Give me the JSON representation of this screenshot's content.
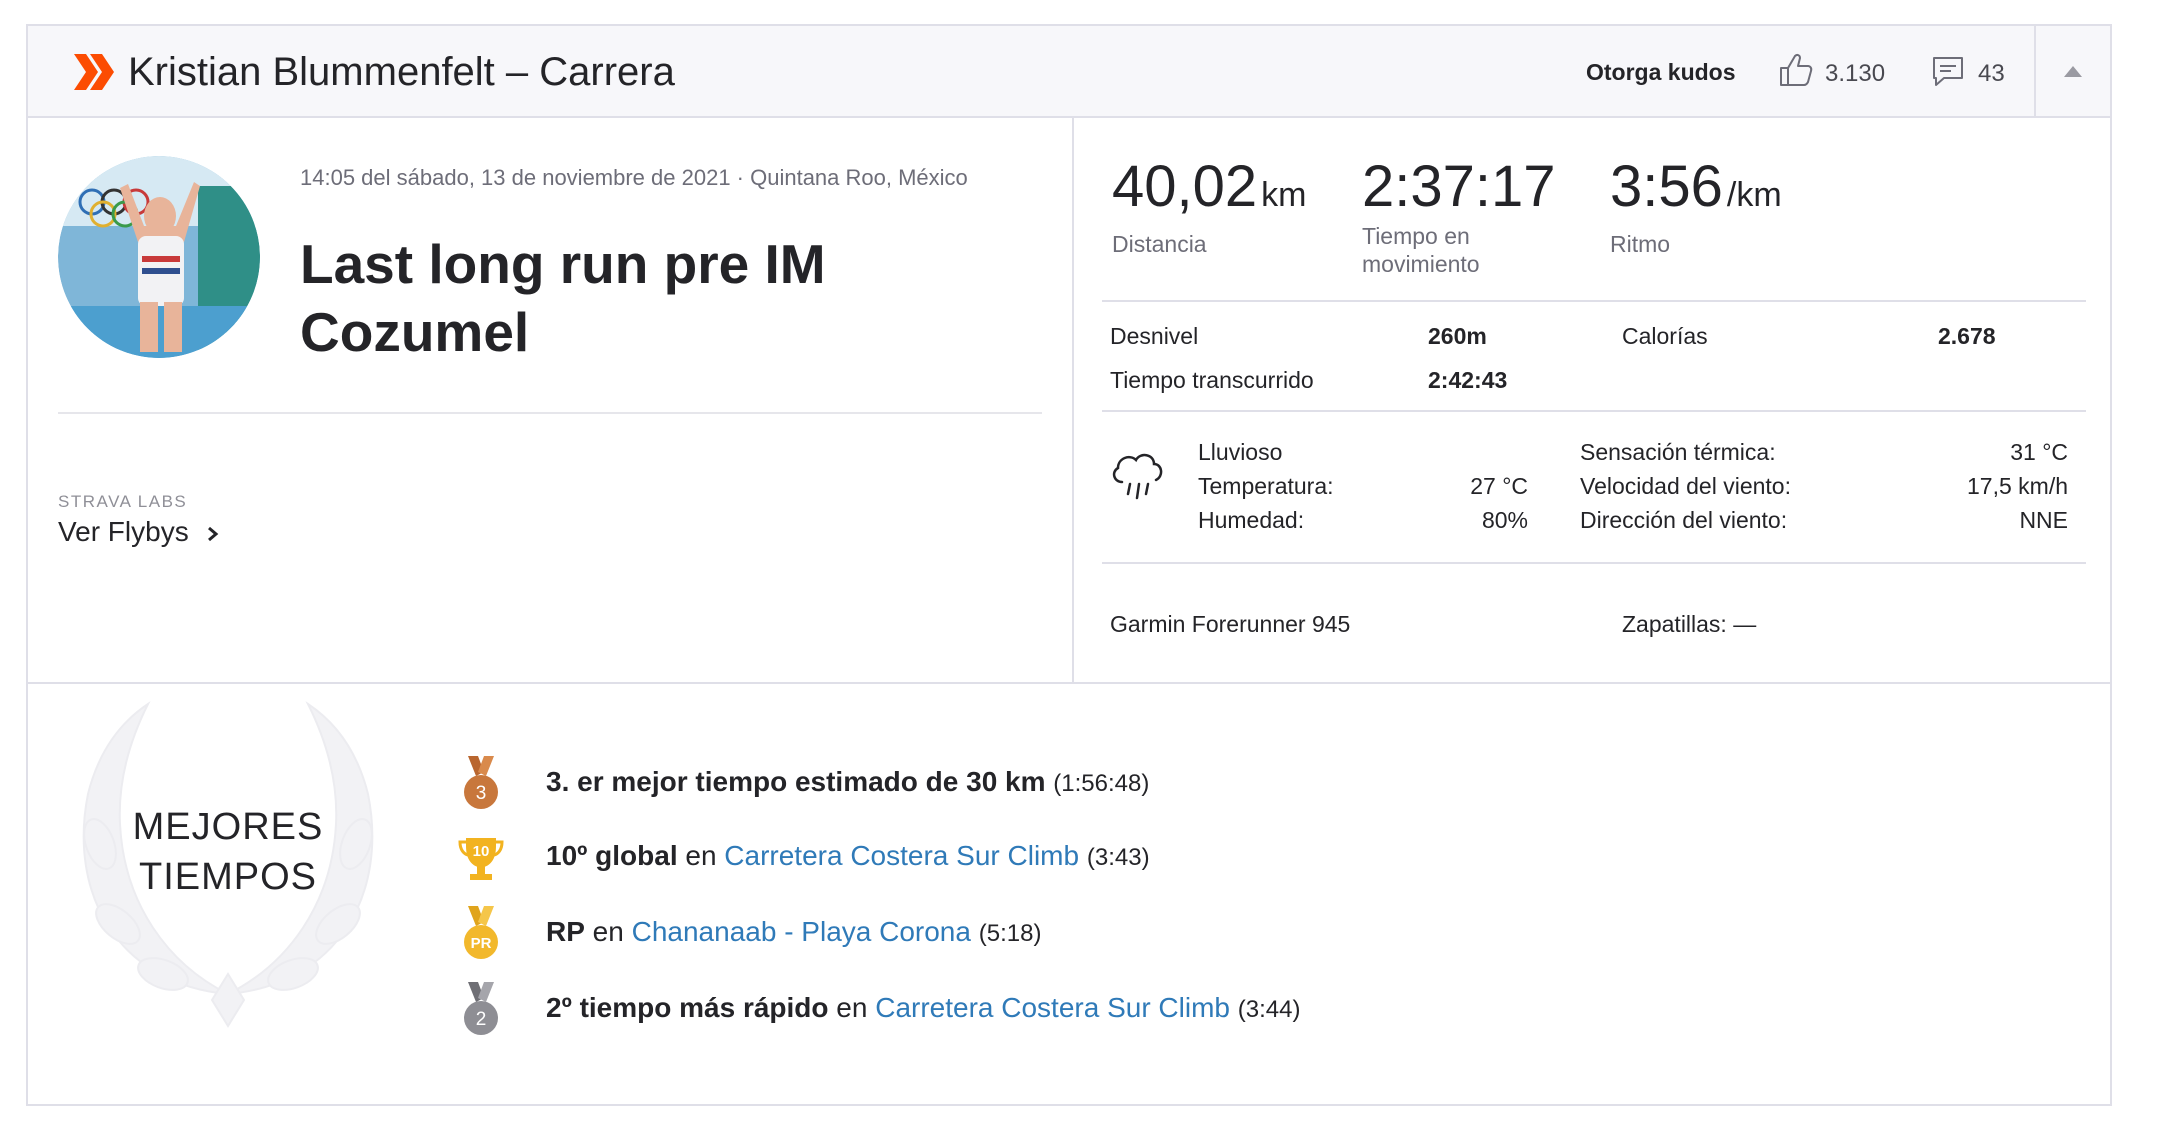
{
  "header": {
    "title": "Kristian Blummenfelt – Carrera",
    "kudos_label": "Otorga kudos",
    "kudos_count": "3.130",
    "comment_count": "43"
  },
  "activity": {
    "date_line": "14:05 del sábado, 13 de noviembre de 2021 · Quintana Roo, México",
    "title": "Last long run pre IM Cozumel",
    "labs_label": "STRAVA LABS",
    "flyby_link": "Ver Flybys"
  },
  "stats": {
    "primary": [
      {
        "value": "40,02",
        "unit": "km",
        "label": "Distancia"
      },
      {
        "value": "2:37:17",
        "unit": "",
        "label": "Tiempo en movimiento"
      },
      {
        "value": "3:56",
        "unit": "/km",
        "label": "Ritmo"
      }
    ],
    "elevation_label": "Desnivel",
    "elevation_value": "260m",
    "calories_label": "Calorías",
    "calories_value": "2.678",
    "elapsed_label": "Tiempo transcurrido",
    "elapsed_value": "2:42:43"
  },
  "weather": {
    "condition": "Lluvioso",
    "temperature_label": "Temperatura:",
    "temperature_value": "27 °C",
    "humidity_label": "Humedad:",
    "humidity_value": "80%",
    "feels_like_label": "Sensación térmica:",
    "feels_like_value": "31 °C",
    "wind_speed_label": "Velocidad del viento:",
    "wind_speed_value": "17,5 km/h",
    "wind_dir_label": "Dirección del viento:",
    "wind_dir_value": "NNE"
  },
  "gear": {
    "device": "Garmin Forerunner 945",
    "shoes": "Zapatillas: —"
  },
  "achievements": {
    "heading_line1": "MEJORES",
    "heading_line2": "TIEMPOS",
    "items": [
      {
        "bold": "3. er mejor tiempo estimado de 30 km",
        "connector": "",
        "link": "",
        "time": "(1:56:48)",
        "badge_text": "3",
        "badge_color": "#c8773c"
      },
      {
        "bold": "10º global",
        "connector": " en ",
        "link": "Carretera Costera Sur Climb",
        "time": "(3:43)",
        "badge_text": "10",
        "badge_color": "#f2b320"
      },
      {
        "bold": "RP",
        "connector": " en ",
        "link": "Chananaab - Playa Corona",
        "time": "(5:18)",
        "badge_text": "PR",
        "badge_color": "#f2b82c"
      },
      {
        "bold": "2º tiempo más rápido",
        "connector": " en ",
        "link": "Carretera Costera Sur Climb",
        "time": "(3:44)",
        "badge_text": "2",
        "badge_color": "#8e8e94"
      }
    ]
  },
  "colors": {
    "brand": "#fc4c02",
    "link": "#2f7ab8",
    "border": "#dfdfe8"
  }
}
